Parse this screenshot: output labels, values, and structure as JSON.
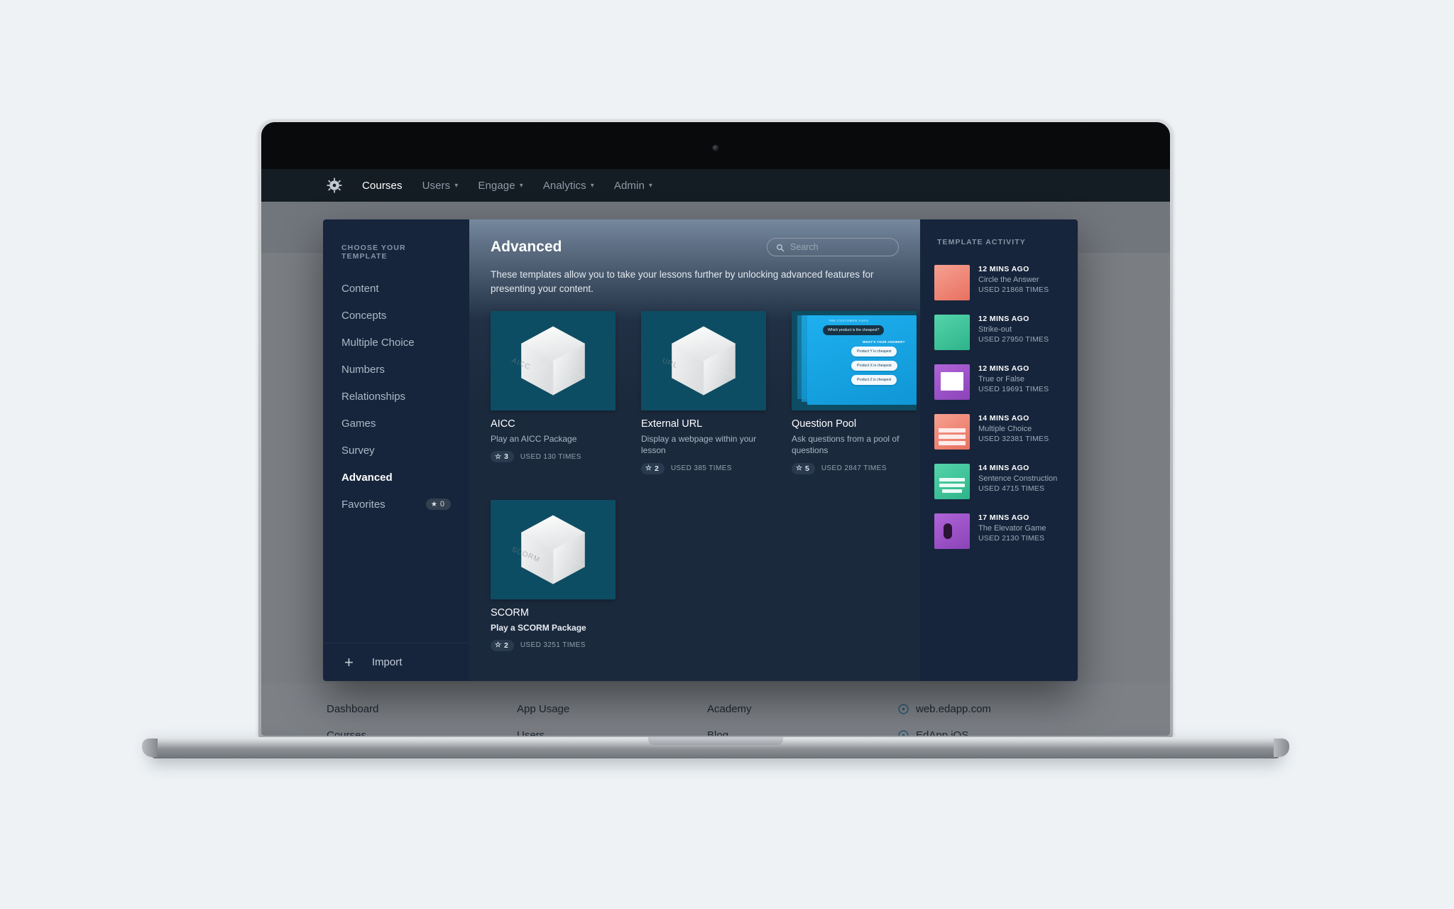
{
  "topnav": {
    "logo_icon": "gear-icon",
    "items": [
      {
        "label": "Courses",
        "active": true,
        "caret": false
      },
      {
        "label": "Users",
        "active": false,
        "caret": true
      },
      {
        "label": "Engage",
        "active": false,
        "caret": true
      },
      {
        "label": "Analytics",
        "active": false,
        "caret": true
      },
      {
        "label": "Admin",
        "active": false,
        "caret": true
      }
    ]
  },
  "footer": {
    "col1": [
      "Dashboard",
      "Courses"
    ],
    "col2": [
      "App Usage",
      "Users"
    ],
    "col3": [
      "Academy",
      "Blog"
    ],
    "col4": [
      {
        "label": "web.edapp.com",
        "icon": "globe-icon"
      },
      {
        "label": "EdApp iOS",
        "icon": "globe-icon"
      }
    ]
  },
  "modal": {
    "close_icon": "close-icon",
    "sidebar": {
      "heading": "CHOOSE YOUR TEMPLATE",
      "items": [
        {
          "label": "Content",
          "active": false
        },
        {
          "label": "Concepts",
          "active": false
        },
        {
          "label": "Multiple Choice",
          "active": false
        },
        {
          "label": "Numbers",
          "active": false
        },
        {
          "label": "Relationships",
          "active": false
        },
        {
          "label": "Games",
          "active": false
        },
        {
          "label": "Survey",
          "active": false
        },
        {
          "label": "Advanced",
          "active": true
        },
        {
          "label": "Favorites",
          "active": false,
          "badge": "0",
          "badge_icon": "star-icon"
        }
      ],
      "import_label": "Import",
      "import_icon": "plus-icon"
    },
    "main": {
      "title": "Advanced",
      "description": "These templates allow you to take your lessons further by unlocking advanced features for presenting your content.",
      "search": {
        "placeholder": "Search",
        "value": "",
        "icon": "search-icon"
      },
      "cards": [
        {
          "title": "AICC",
          "subtitle": "Play an AICC Package",
          "rating": "3",
          "used": "USED 130 TIMES",
          "thumb_type": "cube",
          "cube_label": "AICC",
          "bold_subtitle": false
        },
        {
          "title": "External URL",
          "subtitle": "Display a webpage within your lesson",
          "rating": "2",
          "used": "USED 385 TIMES",
          "thumb_type": "cube",
          "cube_label": "URL",
          "bold_subtitle": false
        },
        {
          "title": "Question Pool",
          "subtitle": "Ask questions from a pool of questions",
          "rating": "5",
          "used": "USED 2847 TIMES",
          "thumb_type": "question-pool",
          "cube_label": "",
          "bold_subtitle": false,
          "preview": {
            "header": "THE CUSTOMER ASKS",
            "question": "Which product is the cheapest?",
            "prompt": "WHAT'S YOUR ANSWER?",
            "answers": [
              "Product Y is cheapest",
              "Product X is cheapest",
              "Product Z is cheapest"
            ]
          }
        },
        {
          "title": "SCORM",
          "subtitle": "Play a SCORM Package",
          "rating": "2",
          "used": "USED 3251 TIMES",
          "thumb_type": "cube",
          "cube_label": "SCORM",
          "bold_subtitle": true
        }
      ]
    },
    "activity": {
      "heading": "TEMPLATE ACTIVITY",
      "items": [
        {
          "time": "12 MINS AGO",
          "name": "Circle the Answer",
          "used": "USED 21868 TIMES",
          "color": "#f08878"
        },
        {
          "time": "12 MINS AGO",
          "name": "Strike-out",
          "used": "USED 27950 TIMES",
          "color": "#3fc49b"
        },
        {
          "time": "12 MINS AGO",
          "name": "True or False",
          "used": "USED 19691 TIMES",
          "color": "#9b53c6"
        },
        {
          "time": "14 MINS AGO",
          "name": "Multiple Choice",
          "used": "USED 32381 TIMES",
          "color": "#f08878"
        },
        {
          "time": "14 MINS AGO",
          "name": "Sentence Construction",
          "used": "USED 4715 TIMES",
          "color": "#3fc49b"
        },
        {
          "time": "17 MINS AGO",
          "name": "The Elevator Game",
          "used": "USED 2130 TIMES",
          "color": "#9b53c6"
        }
      ]
    }
  },
  "colors": {
    "page_bg": "#eef2f5",
    "nav_bg": "#141c24",
    "panel_bg": "#16253c",
    "main_bg": "#1b293d",
    "thumb_bg": "#0d4d63",
    "accent_text": "#ffffff"
  }
}
